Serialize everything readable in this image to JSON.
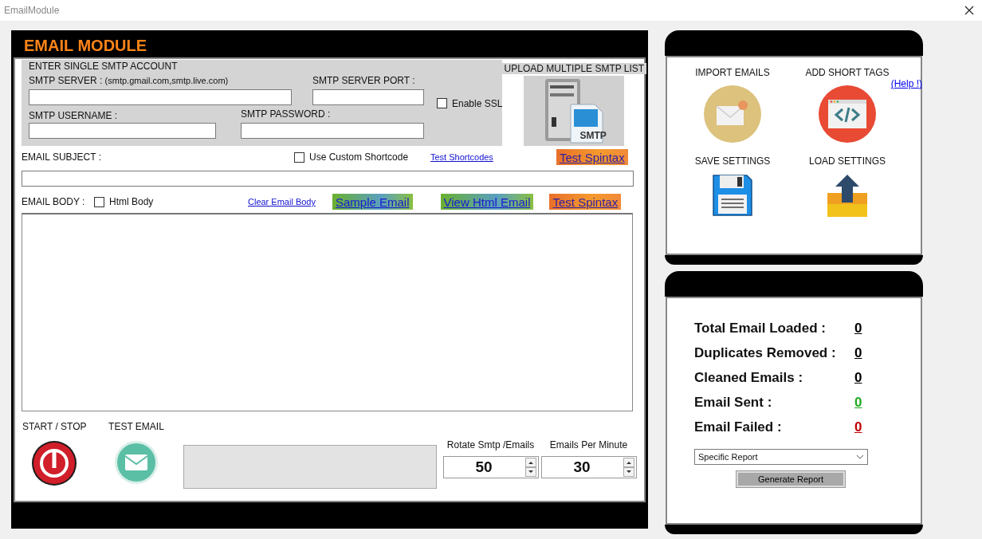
{
  "window": {
    "title": "EmailModule"
  },
  "module": {
    "title": "EMAIL MODULE"
  },
  "smtp_account": {
    "heading": "ENTER SINGLE SMTP ACCOUNT",
    "server_label": "SMTP SERVER :",
    "server_hint": "(smtp.gmail.com,smtp.live.com)",
    "port_label": "SMTP SERVER PORT :",
    "username_label": "SMTP USERNAME :",
    "password_label": "SMTP PASSWORD :",
    "ssl": {
      "label": "Enable SSL",
      "checked": false
    }
  },
  "upload": {
    "label": "UPLOAD MULTIPLE SMTP LIST",
    "icon_text": "SMTP"
  },
  "subject": {
    "label": "EMAIL SUBJECT :",
    "custom_shortcode": {
      "label": "Use Custom Shortcode",
      "checked": false
    },
    "test_shortcodes_link": "Test Shortcodes",
    "test_spintax_button": "Test Spintax"
  },
  "body": {
    "label": "EMAIL BODY :",
    "html_body": {
      "label": "Html Body",
      "checked": false
    },
    "clear_link": "Clear Email Body",
    "buttons": [
      {
        "label": "Sample Email",
        "kind": "green"
      },
      {
        "label": "View Html Email",
        "kind": "green"
      },
      {
        "label": "Test Spintax",
        "kind": "orange"
      }
    ]
  },
  "controls": {
    "start_stop_label": "START / STOP",
    "test_email_label": "TEST EMAIL",
    "spinners": [
      {
        "label": "Rotate Smtp /Emails",
        "value": "50"
      },
      {
        "label": "Emails Per Minute",
        "value": "30"
      }
    ]
  },
  "actions": [
    {
      "label": "IMPORT EMAILS",
      "kind": "import"
    },
    {
      "label": "ADD SHORT TAGS",
      "kind": "tags"
    },
    {
      "label": "SAVE SETTINGS",
      "kind": "save"
    },
    {
      "label": "LOAD SETTINGS",
      "kind": "load"
    }
  ],
  "help_link": "(Help !)",
  "stats": [
    {
      "label": "Total Email Loaded :",
      "value": "0",
      "color": "#000000"
    },
    {
      "label": "Duplicates Removed :",
      "value": "0",
      "color": "#000000"
    },
    {
      "label": "Cleaned Emails :",
      "value": "0",
      "color": "#000000"
    },
    {
      "label": "Email Sent :",
      "value": "0",
      "color": "#1ea91e"
    },
    {
      "label": "Email Failed :",
      "value": "0",
      "color": "#c00000"
    }
  ],
  "report": {
    "select": "Specific Report",
    "button": "Generate Report"
  }
}
